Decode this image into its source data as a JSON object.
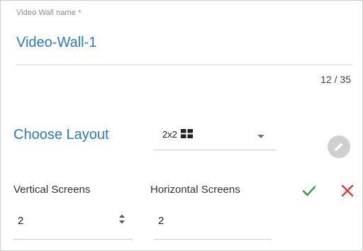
{
  "name_field": {
    "label": "Video Wall name *",
    "value": "Video-Wall-1",
    "counter": "12 / 35"
  },
  "layout": {
    "label": "Choose Layout",
    "selected": "2x2"
  },
  "vertical": {
    "label": "Vertical Screens",
    "value": "2"
  },
  "horizontal": {
    "label": "Horizontal Screens",
    "value": "2"
  },
  "icons": {
    "layout_grid": "grid-2x2-icon",
    "dropdown": "caret-down-icon",
    "edit": "pencil-icon",
    "spinner": "up-down-spinner-icon",
    "confirm": "check-icon",
    "cancel": "close-icon"
  },
  "colors": {
    "accent": "#2a7bc0",
    "confirm": "#2e9e3e",
    "cancel": "#e53935",
    "disabled": "#cfcfcf"
  }
}
